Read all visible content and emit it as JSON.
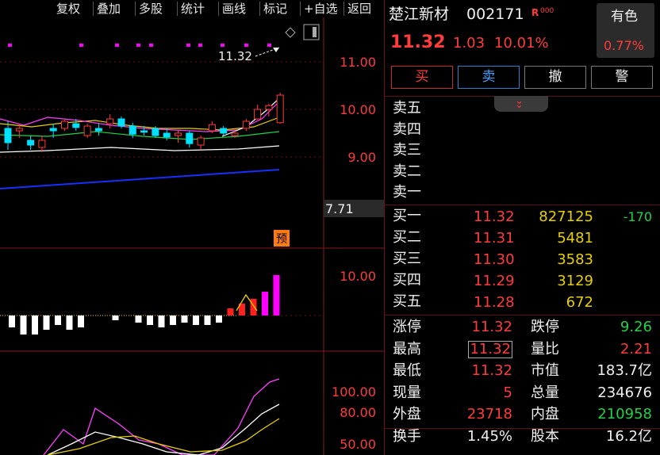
{
  "toolbar": {
    "items": [
      "复权",
      "叠加",
      "多股",
      "统计",
      "画线",
      "标记",
      "+自选",
      "返回"
    ]
  },
  "stock": {
    "name": "楚江新材",
    "code": "002171",
    "tag": "R",
    "tag_extra": "000",
    "price": "11.32",
    "change": "1.03",
    "pct": "10.01%"
  },
  "sector": {
    "label": "有色",
    "pct": "0.77%"
  },
  "buttons": {
    "buy": "买",
    "sell": "卖",
    "cancel": "撤",
    "alert": "警"
  },
  "sell_rows": [
    {
      "label": "卖五"
    },
    {
      "label": "卖四"
    },
    {
      "label": "卖三"
    },
    {
      "label": "卖二"
    },
    {
      "label": "卖一"
    }
  ],
  "buy_rows": [
    {
      "label": "买一",
      "price": "11.32",
      "vol": "827125",
      "delta": "-170"
    },
    {
      "label": "买二",
      "price": "11.31",
      "vol": "5481"
    },
    {
      "label": "买三",
      "price": "11.30",
      "vol": "3583"
    },
    {
      "label": "买四",
      "price": "11.29",
      "vol": "3129"
    },
    {
      "label": "买五",
      "price": "11.28",
      "vol": "672"
    }
  ],
  "stats": [
    {
      "l1": "涨停",
      "v1": "11.32",
      "l2": "跌停",
      "v2": "9.26"
    },
    {
      "l1": "最高",
      "v1": "11.32",
      "l2": "量比",
      "v2": "2.21"
    },
    {
      "l1": "最低",
      "v1": "11.32",
      "l2": "市值",
      "v2": "183.7亿"
    },
    {
      "l1": "现量",
      "v1": "5",
      "l2": "总量",
      "v2": "234676"
    },
    {
      "l1": "外盘",
      "v1": "23718",
      "l2": "内盘",
      "v2": "210958"
    },
    {
      "l1": "换手",
      "v1": "1.45%",
      "l2": "股本",
      "v2": "16.2亿"
    }
  ],
  "chart_labels": {
    "last_price_tag": "11.32",
    "cur_box": "7.71",
    "yu": "预"
  },
  "colors": {
    "up": "#ff3b3b",
    "down": "#22d14a",
    "cyan": "#00e0ff",
    "magenta": "#ff00ff",
    "border": "#8b1a1a"
  },
  "chart_data": [
    {
      "type": "candlestick",
      "yticks": [
        "11.00",
        "10.00",
        "9.00"
      ],
      "ylim": [
        8.6,
        11.5
      ],
      "candles": [
        {
          "o": 9.6,
          "h": 9.75,
          "l": 9.15,
          "c": 9.3
        },
        {
          "o": 9.55,
          "h": 9.7,
          "l": 9.4,
          "c": 9.6
        },
        {
          "o": 9.35,
          "h": 9.45,
          "l": 9.15,
          "c": 9.25
        },
        {
          "o": 9.2,
          "h": 9.45,
          "l": 9.1,
          "c": 9.35
        },
        {
          "o": 9.6,
          "h": 9.7,
          "l": 9.4,
          "c": 9.55
        },
        {
          "o": 9.6,
          "h": 9.78,
          "l": 9.55,
          "c": 9.75
        },
        {
          "o": 9.7,
          "h": 9.8,
          "l": 9.55,
          "c": 9.62
        },
        {
          "o": 9.45,
          "h": 9.7,
          "l": 9.4,
          "c": 9.65
        },
        {
          "o": 9.6,
          "h": 9.7,
          "l": 9.45,
          "c": 9.55
        },
        {
          "o": 9.7,
          "h": 9.9,
          "l": 9.6,
          "c": 9.8
        },
        {
          "o": 9.8,
          "h": 9.85,
          "l": 9.6,
          "c": 9.65
        },
        {
          "o": 9.65,
          "h": 9.72,
          "l": 9.4,
          "c": 9.48
        },
        {
          "o": 9.55,
          "h": 9.65,
          "l": 9.45,
          "c": 9.52
        },
        {
          "o": 9.6,
          "h": 9.65,
          "l": 9.4,
          "c": 9.45
        },
        {
          "o": 9.5,
          "h": 9.6,
          "l": 9.35,
          "c": 9.42
        },
        {
          "o": 9.45,
          "h": 9.55,
          "l": 9.3,
          "c": 9.5
        },
        {
          "o": 9.5,
          "h": 9.55,
          "l": 9.2,
          "c": 9.28
        },
        {
          "o": 9.25,
          "h": 9.45,
          "l": 9.15,
          "c": 9.4
        },
        {
          "o": 9.55,
          "h": 9.75,
          "l": 9.5,
          "c": 9.68
        },
        {
          "o": 9.6,
          "h": 9.65,
          "l": 9.45,
          "c": 9.5
        },
        {
          "o": 9.45,
          "h": 9.55,
          "l": 9.4,
          "c": 9.5
        },
        {
          "o": 9.6,
          "h": 9.8,
          "l": 9.55,
          "c": 9.75
        },
        {
          "o": 9.8,
          "h": 10.1,
          "l": 9.78,
          "c": 10.0
        },
        {
          "o": 10.0,
          "h": 10.12,
          "l": 9.85,
          "c": 10.08
        },
        {
          "o": 9.72,
          "h": 10.35,
          "l": 9.7,
          "c": 10.3
        }
      ]
    },
    {
      "type": "bar",
      "ytick": "10.00",
      "values": [
        -0.5,
        -0.8,
        -0.8,
        -0.6,
        -0.4,
        -0.6,
        -0.5,
        0,
        0,
        -0.2,
        0,
        -0.3,
        -0.4,
        -0.5,
        -0.4,
        -0.3,
        -0.4,
        -0.4,
        -0.3,
        0.3,
        0.5,
        0.7,
        1.0,
        1.7
      ]
    },
    {
      "type": "line",
      "yticks": [
        "100.00",
        "80.00",
        "50.00"
      ]
    }
  ]
}
